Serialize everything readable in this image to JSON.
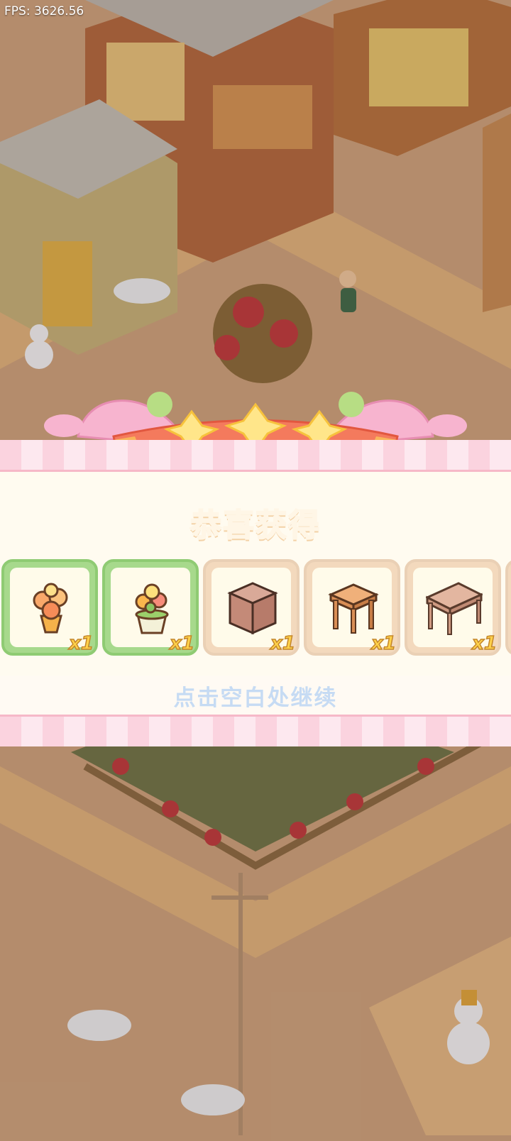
{
  "hud": {
    "fps": "FPS: 3626.56"
  },
  "dialog": {
    "title": "恭喜获得",
    "hint": "点击空白处继续",
    "rewards": [
      {
        "icon": "orange-flower-bouquet-icon",
        "qty": "x1",
        "frame": "green"
      },
      {
        "icon": "flower-pot-icon",
        "qty": "x1",
        "frame": "green"
      },
      {
        "icon": "wooden-cabinet-icon",
        "qty": "x1",
        "frame": "tan"
      },
      {
        "icon": "wooden-stool-icon",
        "qty": "x1",
        "frame": "tan"
      },
      {
        "icon": "wooden-desk-icon",
        "qty": "x1",
        "frame": "tan"
      }
    ]
  },
  "colors": {
    "title": "#b06538",
    "hint": "#c6dbf3",
    "stripe": "#fbd3df",
    "quantity": "#ffd24a"
  }
}
